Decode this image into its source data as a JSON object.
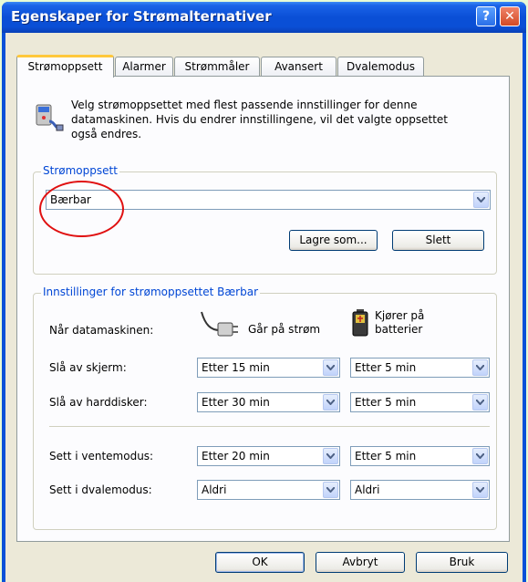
{
  "window": {
    "title": "Egenskaper for Strømalternativer",
    "help_glyph": "?",
    "close_glyph": "✕"
  },
  "tabs": [
    {
      "label": "Strømoppsett",
      "active": true
    },
    {
      "label": "Alarmer",
      "active": false
    },
    {
      "label": "Strømmåler",
      "active": false
    },
    {
      "label": "Avansert",
      "active": false
    },
    {
      "label": "Dvalemodus",
      "active": false
    }
  ],
  "intro": {
    "text": "Velg strømoppsettet med flest passende innstillinger for denne datamaskinen. Hvis du endrer innstillingene, vil det valgte oppsettet også endres.",
    "icon": "power-options-icon"
  },
  "scheme_group": {
    "label": "Strømoppsett",
    "selected_scheme": "Bærbar",
    "save_as_label": "Lagre som...",
    "delete_label": "Slett"
  },
  "settings_group": {
    "label": "Innstillinger for strømoppsettet Bærbar",
    "when_label": "Når datamaskinen:",
    "plugged_in_label": "Går på strøm",
    "on_battery_label": "Kjører på batterier",
    "plugged_in_icon": "power-plug-icon",
    "battery_icon": "battery-icon",
    "rows": [
      {
        "label": "Slå av skjerm:",
        "plugged": "Etter 15 min",
        "battery": "Etter 5 min"
      },
      {
        "label": "Slå av harddisker:",
        "plugged": "Etter 30 min",
        "battery": "Etter 5 min"
      },
      {
        "label": "Sett i ventemodus:",
        "plugged": "Etter 20 min",
        "battery": "Etter 5 min"
      },
      {
        "label": "Sett i dvalemodus:",
        "plugged": "Aldri",
        "battery": "Aldri"
      }
    ]
  },
  "buttons": {
    "ok": "OK",
    "cancel": "Avbryt",
    "apply": "Bruk"
  },
  "colors": {
    "titlebar": "#0a4fd6",
    "group_label": "#0046d5",
    "annotation": "#e01010",
    "background": "#e8fbd6"
  }
}
